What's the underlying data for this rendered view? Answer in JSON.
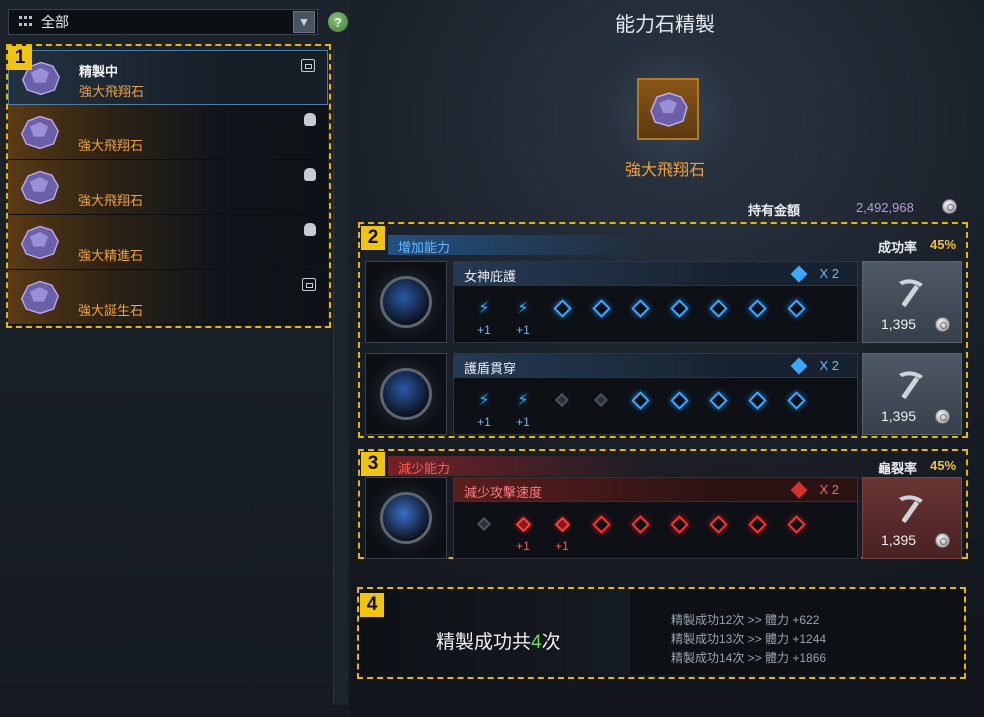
{
  "filter": {
    "label": "全部",
    "dropdown_icon": "chevron-down-icon",
    "help_glyph": "?"
  },
  "list": {
    "items": [
      {
        "head": "精製中",
        "name": "強大飛翔石",
        "badge": "chest-icon",
        "selected": true
      },
      {
        "head": "",
        "name": "強大飛翔石",
        "badge": "bag-icon",
        "selected": false
      },
      {
        "head": "",
        "name": "強大飛翔石",
        "badge": "bag-icon",
        "selected": false
      },
      {
        "head": "",
        "name": "強大精進石",
        "badge": "bag-icon",
        "selected": false
      },
      {
        "head": "",
        "name": "強大誕生石",
        "badge": "chest-icon",
        "selected": false
      }
    ]
  },
  "markers": {
    "m1": "1",
    "m2": "2",
    "m3": "3",
    "m4": "4"
  },
  "panel": {
    "title": "能力石精製",
    "item_name": "強大飛翔石",
    "gold_label": "持有金額",
    "gold_value": "2,492,968"
  },
  "increase": {
    "title": "增加能力",
    "rate_label": "成功率",
    "rate_value": "45%",
    "rows": [
      {
        "name": "女神庇護",
        "multiplier": "X 2",
        "cost": "1,395",
        "plus1": "+1",
        "plus2": "+1",
        "slots": [
          "success",
          "success",
          "empty",
          "empty",
          "empty",
          "empty",
          "empty",
          "empty",
          "empty"
        ]
      },
      {
        "name": "護盾貫穿",
        "multiplier": "X 2",
        "cost": "1,395",
        "plus1": "+1",
        "plus2": "+1",
        "slots": [
          "success",
          "success",
          "fail",
          "fail",
          "empty",
          "empty",
          "empty",
          "empty",
          "empty"
        ]
      }
    ]
  },
  "decrease": {
    "title": "減少能力",
    "rate_label": "龜裂率",
    "rate_value": "45%",
    "rows": [
      {
        "name": "減少攻擊速度",
        "multiplier": "X 2",
        "cost": "1,395",
        "plus1": "+1",
        "plus2": "+1",
        "slots": [
          "fail",
          "success",
          "success",
          "empty",
          "empty",
          "empty",
          "empty",
          "empty",
          "empty"
        ]
      }
    ]
  },
  "summary": {
    "prefix": "精製成功共",
    "count": "4",
    "suffix": "次",
    "lines": [
      "精製成功12次 >> 體力 +622",
      "精製成功13次 >> 體力 +1244",
      "精製成功14次 >> 體力 +1866"
    ]
  },
  "colors": {
    "accent_orange": "#f0a23a",
    "marker_yellow": "#f1c40f",
    "increase_blue": "#3aa8ff",
    "decrease_red": "#ff3030",
    "success_green": "#6fdc5a",
    "gold_purple": "#b79ad8"
  }
}
